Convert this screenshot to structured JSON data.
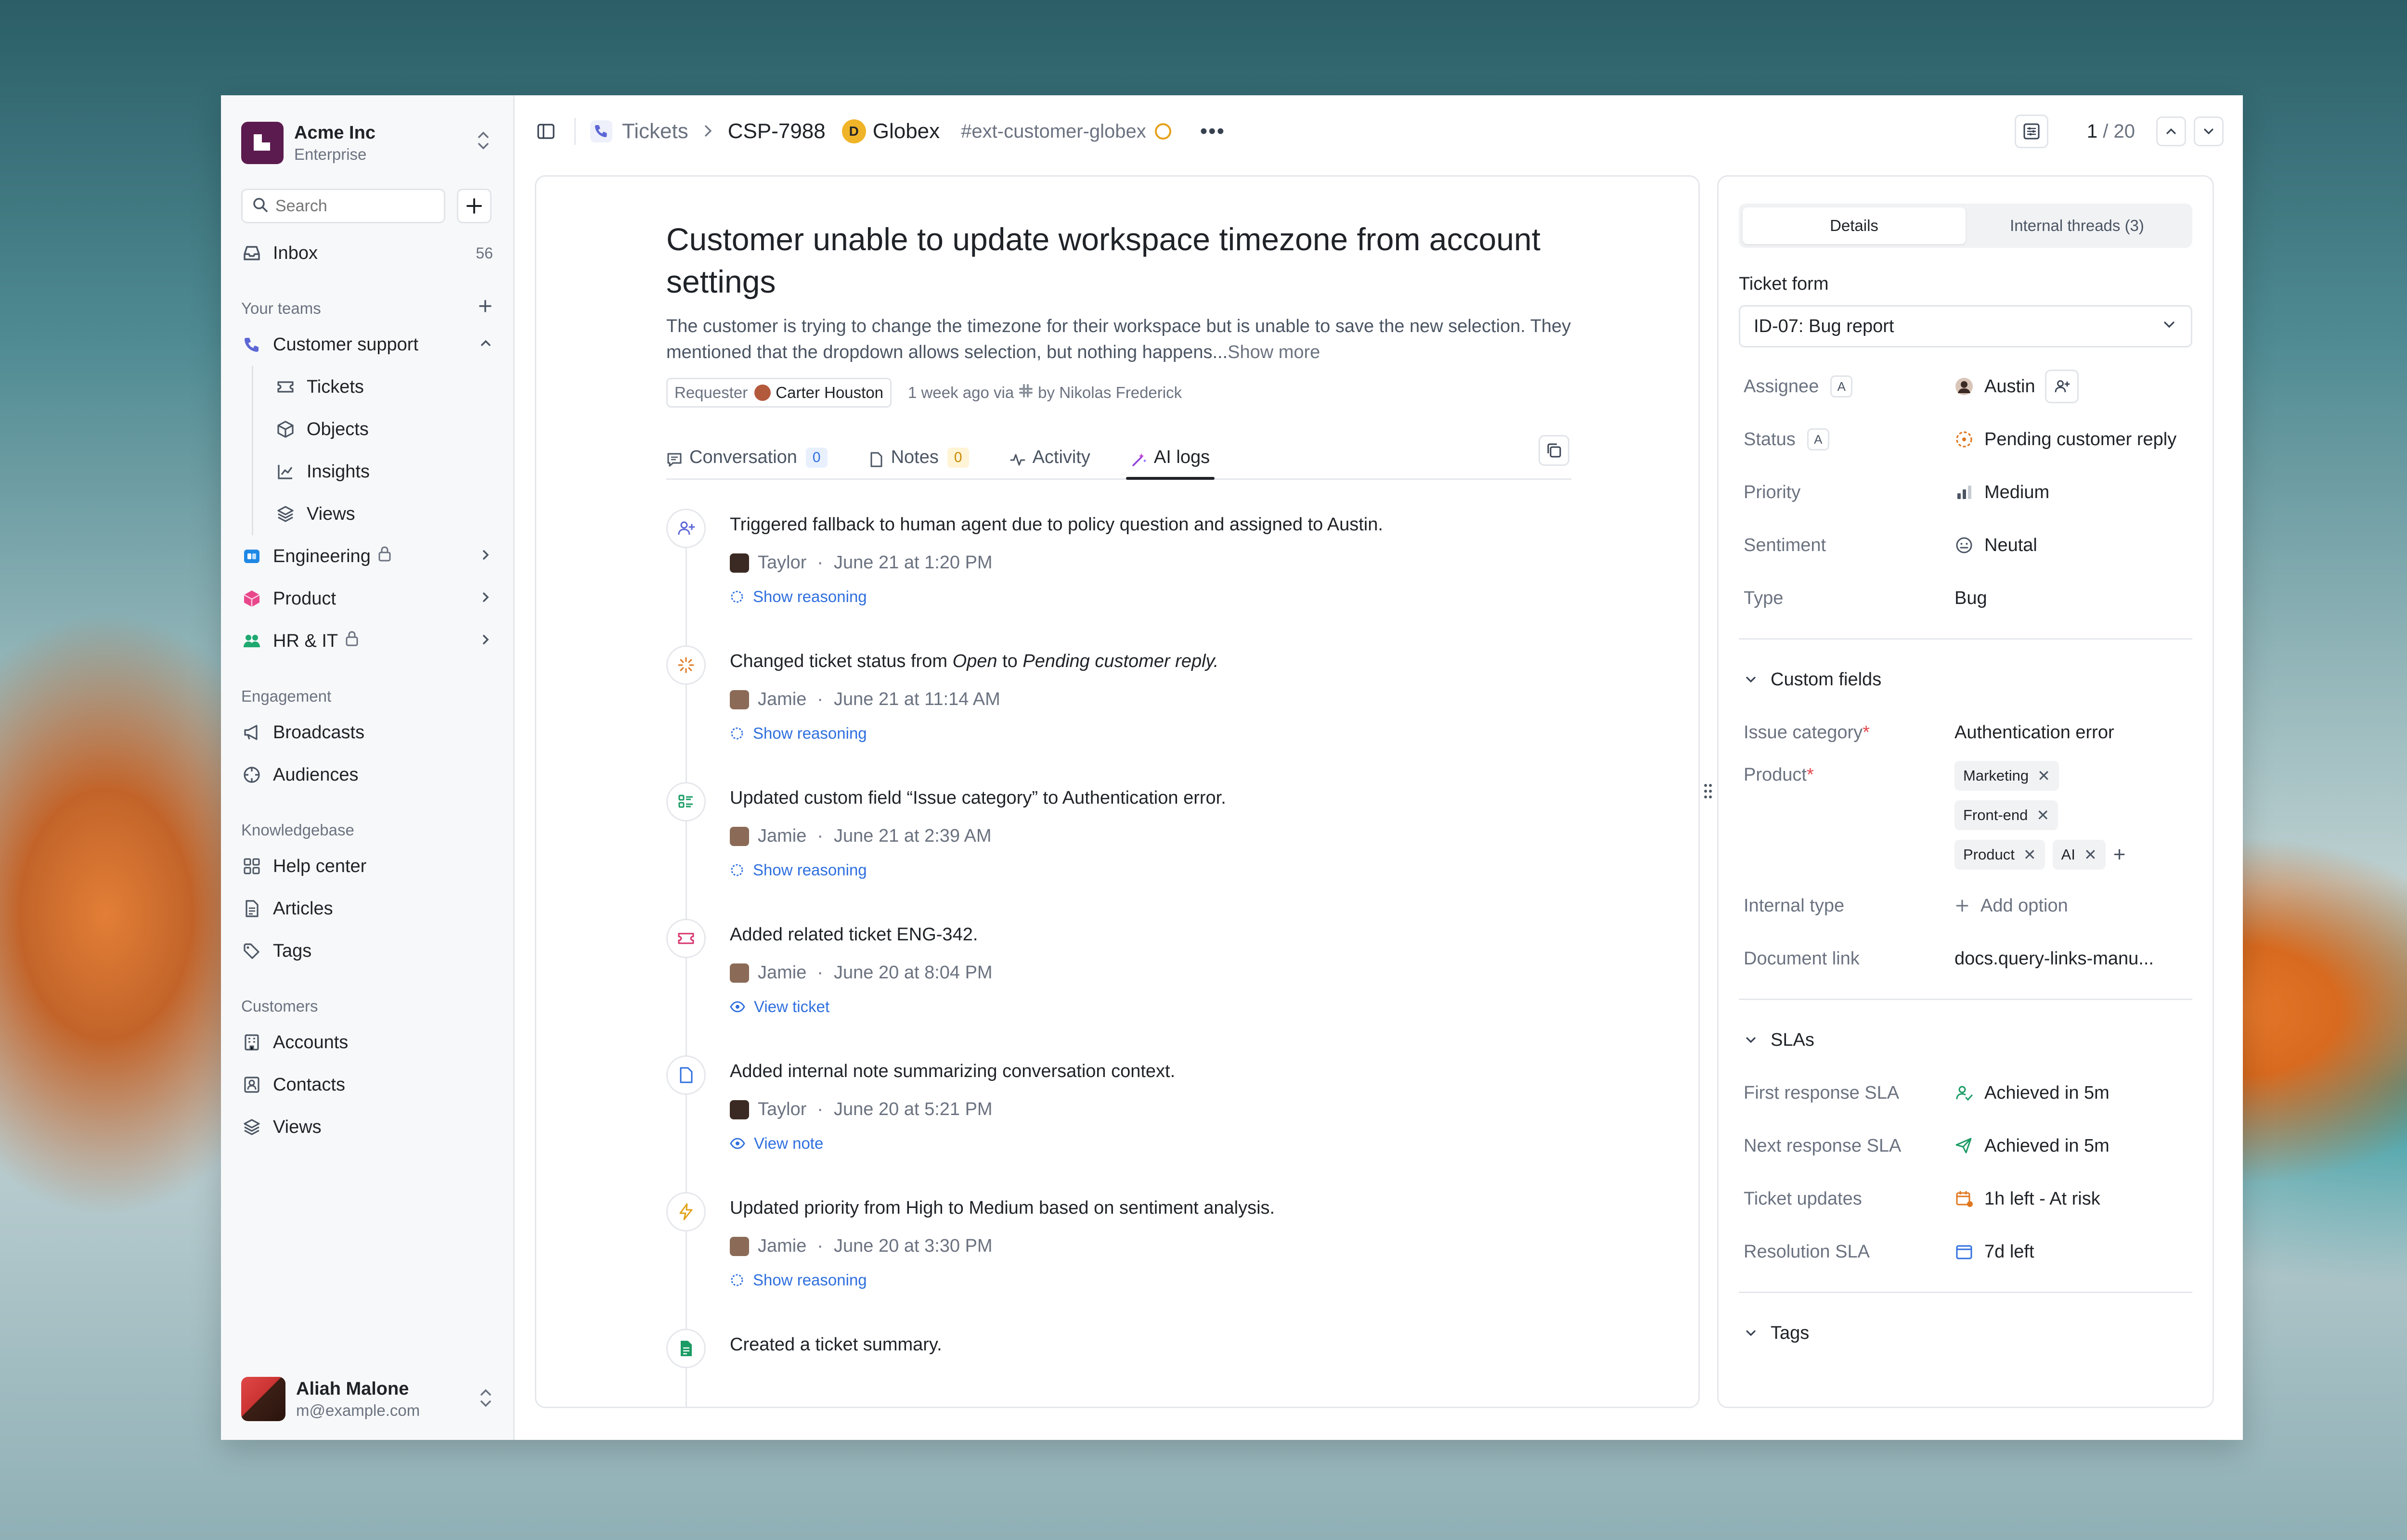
{
  "workspace": {
    "name": "Acme Inc",
    "plan": "Enterprise"
  },
  "search": {
    "placeholder": "Search"
  },
  "inbox": {
    "label": "Inbox",
    "count": "56"
  },
  "teams": {
    "section_label": "Your teams",
    "customer_support": "Customer support",
    "sub_items": [
      "Tickets",
      "Objects",
      "Insights",
      "Views"
    ],
    "engineering": "Engineering",
    "product": "Product",
    "hr_it": "HR & IT"
  },
  "engagement": {
    "section_label": "Engagement",
    "items": [
      "Broadcasts",
      "Audiences"
    ]
  },
  "knowledgebase": {
    "section_label": "Knowledgebase",
    "items": [
      "Help center",
      "Articles",
      "Tags"
    ]
  },
  "customers": {
    "section_label": "Customers",
    "items": [
      "Accounts",
      "Contacts",
      "Views"
    ]
  },
  "user": {
    "name": "Aliah Malone",
    "email": "m@example.com"
  },
  "topbar": {
    "crumb_tickets": "Tickets",
    "ticket_id": "CSP-7988",
    "company_initial": "D",
    "company": "Globex",
    "channel": "#ext-customer-globex",
    "more": "•••",
    "pager_current": "1",
    "pager_total": "/ 20"
  },
  "ticket": {
    "title": "Customer unable to update workspace timezone from account settings",
    "description": "The customer is trying to change the timezone for their workspace but is unable to save the new selection. They mentioned that the dropdown allows selection, but nothing happens...",
    "show_more": "Show more",
    "requester_label": "Requester",
    "requester_name": "Carter Houston",
    "meta_time": "1 week ago via",
    "meta_by": "by Nikolas Frederick"
  },
  "tabs": {
    "conversation": "Conversation",
    "conversation_count": "0",
    "notes": "Notes",
    "notes_count": "0",
    "activity": "Activity",
    "ai_logs": "AI logs"
  },
  "logs": [
    {
      "title": "Triggered fallback to human agent due to policy question and assigned to Austin.",
      "user": "Taylor",
      "time": "June 21 at 1:20 PM",
      "action": "Show reasoning"
    },
    {
      "title_pre": "Changed ticket status from ",
      "title_em1": "Open",
      "title_mid": " to ",
      "title_em2": "Pending customer reply.",
      "user": "Jamie",
      "time": "June 21 at 11:14 AM",
      "action": "Show reasoning"
    },
    {
      "title": "Updated custom field “Issue category” to Authentication error.",
      "user": "Jamie",
      "time": "June 21 at 2:39 AM",
      "action": "Show reasoning"
    },
    {
      "title": "Added related ticket ENG-342.",
      "user": "Jamie",
      "time": "June 20 at 8:04 PM",
      "action": "View ticket"
    },
    {
      "title": "Added internal note summarizing conversation context.",
      "user": "Taylor",
      "time": "June 20 at 5:21 PM",
      "action": "View note"
    },
    {
      "title": "Updated priority from High to Medium based on sentiment analysis.",
      "user": "Jamie",
      "time": "June 20 at 3:30 PM",
      "action": "Show reasoning"
    },
    {
      "title": "Created a ticket summary."
    }
  ],
  "panel": {
    "tab_details": "Details",
    "tab_threads": "Internal threads (3)",
    "ticket_form_label": "Ticket form",
    "ticket_form_value": "ID-07: Bug report",
    "assignee_label": "Assignee",
    "assignee_kbd": "A",
    "assignee_value": "Austin",
    "status_label": "Status",
    "status_kbd": "A",
    "status_value": "Pending customer reply",
    "priority_label": "Priority",
    "priority_value": "Medium",
    "sentiment_label": "Sentiment",
    "sentiment_value": "Neutal",
    "type_label": "Type",
    "type_value": "Bug",
    "custom_fields": "Custom fields",
    "issue_category_label": "Issue category",
    "issue_category_value": "Authentication error",
    "product_label": "Product",
    "product_chips": [
      "Marketing",
      "Front-end",
      "Product",
      "AI"
    ],
    "internal_type_label": "Internal type",
    "add_option": "Add option",
    "document_link_label": "Document link",
    "document_link_value": "docs.query-links-manu...",
    "slas": "SLAs",
    "first_response_label": "First response SLA",
    "first_response_value": "Achieved in 5m",
    "next_response_label": "Next response SLA",
    "next_response_value": "Achieved in 5m",
    "ticket_updates_label": "Ticket updates",
    "ticket_updates_value": "1h left - At risk",
    "resolution_label": "Resolution SLA",
    "resolution_value": "7d left",
    "tags": "Tags",
    "required_mark": "*"
  },
  "colors": {
    "accent_blue": "#2f6fde",
    "success": "#1a9b63",
    "warning": "#e0771f",
    "workspace_logo": "#5b1b4f"
  }
}
